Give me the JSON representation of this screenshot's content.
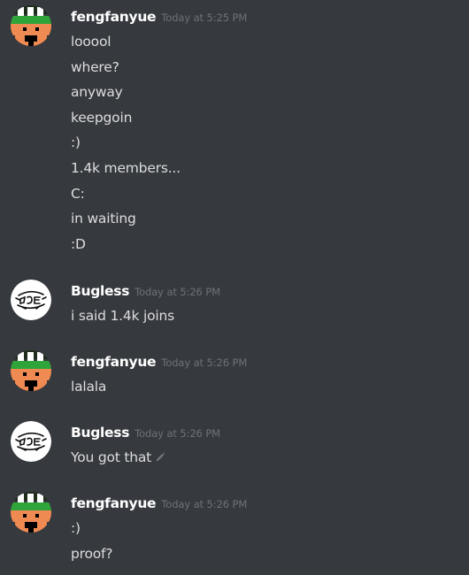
{
  "messages": [
    {
      "author": "fengfanyue",
      "avatar_icon": "green-helmet-avatar-icon",
      "timestamp": "Today at 5:25 PM",
      "lines": [
        "looool",
        "where?",
        "anyway",
        "keepgoin",
        ":)",
        "1.4k members...",
        "C:",
        "in waiting",
        ":D"
      ]
    },
    {
      "author": "Bugless",
      "avatar_icon": "bugless-logo-avatar-icon",
      "timestamp": "Today at 5:26 PM",
      "lines": [
        "i said 1.4k joins"
      ]
    },
    {
      "author": "fengfanyue",
      "avatar_icon": "green-helmet-avatar-icon",
      "timestamp": "Today at 5:26 PM",
      "lines": [
        "lalala"
      ]
    },
    {
      "author": "Bugless",
      "avatar_icon": "bugless-logo-avatar-icon",
      "timestamp": "Today at 5:26 PM",
      "lines": [
        "You got that"
      ],
      "edit_icon": "pencil-icon"
    },
    {
      "author": "fengfanyue",
      "avatar_icon": "green-helmet-avatar-icon",
      "timestamp": "Today at 5:26 PM",
      "lines": [
        ":)",
        "proof?"
      ]
    }
  ],
  "colors": {
    "background": "#36393e",
    "username": "#ffffff",
    "message_text": "#dcddde",
    "timestamp": "#6e7178",
    "avatar_green": "#2fa43a",
    "avatar_skin": "#ef8a52"
  }
}
